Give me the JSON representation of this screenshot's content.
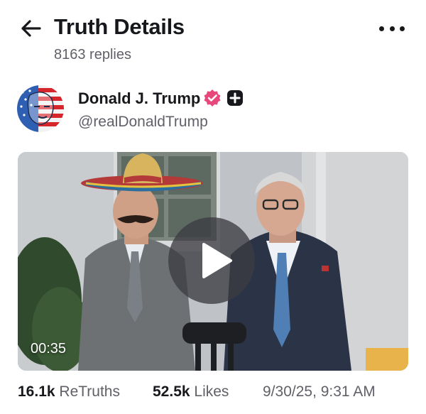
{
  "header": {
    "title": "Truth Details",
    "replies": "8163 replies",
    "back_icon": "arrow-left-icon",
    "more_icon": "more-horizontal-icon"
  },
  "author": {
    "display_name": "Donald J. Trump",
    "handle": "@realDonaldTrump",
    "verified_icon": "verified-badge-icon",
    "badge_icon": "plus-square-icon",
    "verified_color": "#e8477c"
  },
  "media": {
    "type": "video",
    "duration": "00:35",
    "play_icon": "play-icon"
  },
  "stats": {
    "retruths_count": "16.1k",
    "retruths_label": "ReTruths",
    "likes_count": "52.5k",
    "likes_label": "Likes",
    "timestamp": "9/30/25, 9:31 AM"
  }
}
